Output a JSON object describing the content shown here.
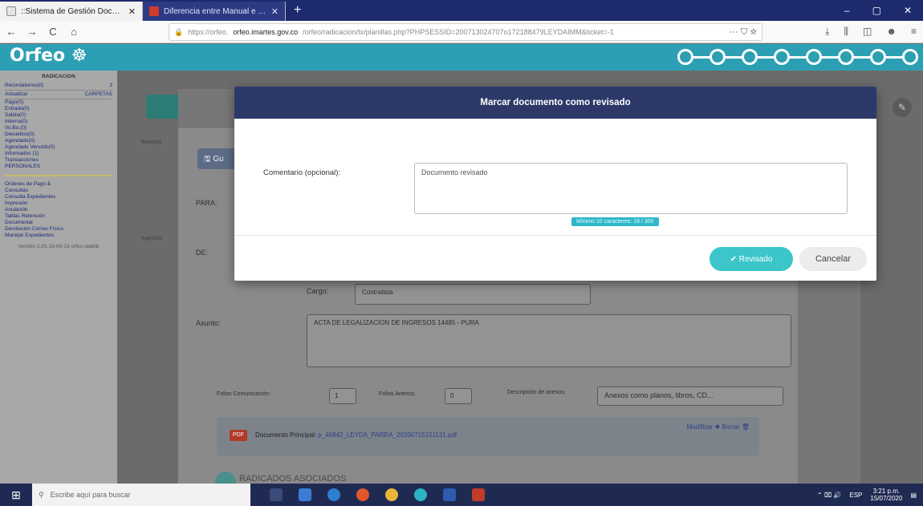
{
  "browser": {
    "tabs": [
      {
        "label": "::Sistema de Gestión Docum...",
        "active": true
      },
      {
        "label": "Diferencia entre Manual e Incl...",
        "active": false
      }
    ],
    "new_tab": "+",
    "window_buttons": [
      "–",
      "▢",
      "✕"
    ],
    "url_host": "orfeo.imartes.gov.co",
    "url_prefix": "https://orfeo.",
    "url_rest": "/orfeo/radicacion/tx/planillas.php?PHPSESSID=200713024707o172188479LEYDAIMM&ticket=-1",
    "url_icons": "··· ⛉ ☆",
    "nav_icons": [
      "←",
      "→",
      "C",
      "⌂"
    ],
    "right_icons": [
      "⤓",
      "⫼",
      "◫",
      "☻",
      "≡"
    ]
  },
  "app": {
    "logo": "Orfeo",
    "header_color": "#2d9fb4"
  },
  "sidebar": {
    "title": "RADICACION",
    "row1": {
      "left": "Recordatorios(0)",
      "right": "3"
    },
    "row2": {
      "left": "Actualizar",
      "right": "CARPETAS"
    },
    "folders": [
      "Pago(0)",
      "Entrada(0)",
      "Salida(0)",
      "Interna(0)",
      "Vo.Bo.(0)",
      "Devueltos(0)",
      "Agendado(0)",
      "Agendado Vencido(0)",
      "Informados (1)",
      "Transacciones",
      "PERSONALES"
    ],
    "links": [
      "Ordenes de Pago &",
      "Consultas",
      "Consulta Expedientes",
      "Impresión",
      "Anulación",
      "Tablas Retención",
      "Documental",
      "Devolución Correo Físico",
      "Manejar Expedientes"
    ],
    "version": "Versión 2.01.18-09-19 orfeo-dabbb"
  },
  "main": {
    "gu_label": "Gu",
    "para": "PARA:",
    "de": "DE:",
    "side_note_1": "Bandeja",
    "side_note_2": "Agendar",
    "cargo_label": "Cargo:",
    "cargo_value": "Contratista",
    "asunto_label": "Asunto:",
    "asunto_value": "ACTA DE LEGALIZACION DE INGRESOS 14485 - PURA",
    "folios_label": "Folios Comunicación:",
    "folios_value": "1",
    "anexos_label": "Folios Anexos:",
    "anexos_value": "0",
    "desc_label": "Descripción de anexos:",
    "desc_placeholder": "Anexos como planos, libros, CD...",
    "pdf_badge": "PDF",
    "doc_principal_label": "Documento Principal:",
    "doc_principal_file": "p_46842_LEYDA_PARRA_20200715151131.pdf",
    "modificar": "Modificar ✚",
    "borrar": "Borrar 🗑",
    "radicados_asociados": "RADICADOS ASOCIADOS"
  },
  "modal": {
    "title": "Marcar documento como revisado",
    "comment_label": "Comentario (opcional):",
    "comment_value": "Documento revisado",
    "counter": "Mínimo 10 caracteres: 18 / 300",
    "revisado_label": "✔ Revisado",
    "cancel_label": "Cancelar"
  },
  "taskbar": {
    "search_placeholder": "Escribe aquí para buscar",
    "time": "3:21 p.m.",
    "date": "15/07/2020",
    "lang": "ESP",
    "tray_icons": "⌃ ⌧ 🔊"
  }
}
